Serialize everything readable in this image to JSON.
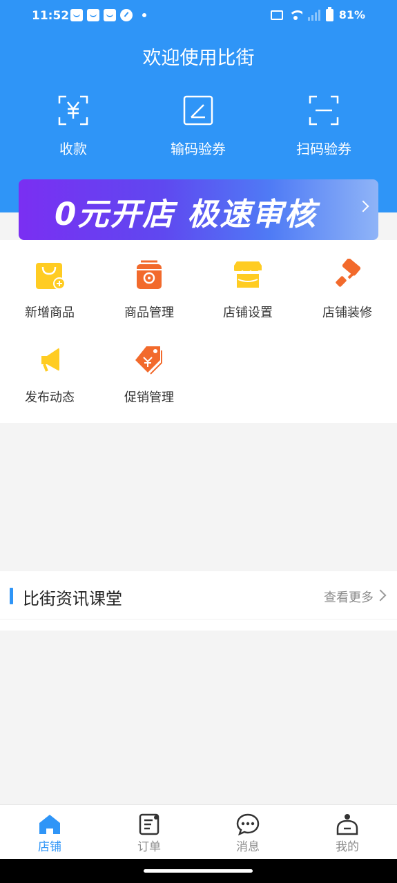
{
  "status_bar": {
    "time": "11:52",
    "battery": "81%"
  },
  "header": {
    "title": "欢迎使用比街",
    "quick_actions": [
      {
        "label": "收款",
        "icon": "yuan-scan-icon"
      },
      {
        "label": "输码验券",
        "icon": "edit-code-icon"
      },
      {
        "label": "扫码验券",
        "icon": "scan-icon"
      }
    ]
  },
  "banner": {
    "text": "0元开店 极速审核"
  },
  "menu": {
    "items": [
      {
        "label": "新增商品",
        "icon": "add-product-bag-icon"
      },
      {
        "label": "商品管理",
        "icon": "product-manage-icon"
      },
      {
        "label": "店铺设置",
        "icon": "shop-settings-icon"
      },
      {
        "label": "店铺装修",
        "icon": "paint-roller-icon"
      },
      {
        "label": "发布动态",
        "icon": "megaphone-icon"
      },
      {
        "label": "促销管理",
        "icon": "price-tag-icon"
      }
    ]
  },
  "news": {
    "title": "比街资讯课堂",
    "more": "查看更多"
  },
  "tabbar": {
    "tabs": [
      {
        "label": "店铺",
        "icon": "home-icon",
        "active": true
      },
      {
        "label": "订单",
        "icon": "order-icon",
        "active": false
      },
      {
        "label": "消息",
        "icon": "message-icon",
        "active": false
      },
      {
        "label": "我的",
        "icon": "profile-icon",
        "active": false
      }
    ]
  },
  "colors": {
    "primary": "#2f95f7",
    "orange": "#f26a2c",
    "yellow": "#ffcc22"
  }
}
